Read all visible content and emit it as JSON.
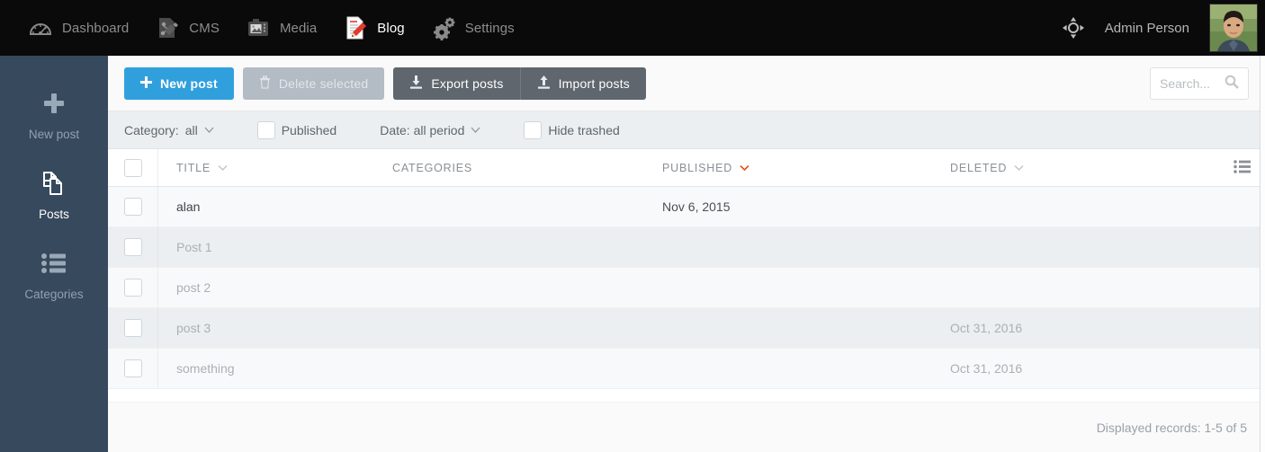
{
  "topbar": {
    "nav": [
      {
        "label": "Dashboard",
        "icon": "gauge-icon",
        "active": false
      },
      {
        "label": "CMS",
        "icon": "sitemap-document-icon",
        "active": false
      },
      {
        "label": "Media",
        "icon": "camera-icon",
        "active": false
      },
      {
        "label": "Blog",
        "icon": "document-pencil-icon",
        "active": true
      },
      {
        "label": "Settings",
        "icon": "gears-icon",
        "active": false
      }
    ],
    "move_icon": "move-crosshair-icon",
    "admin_name": "Admin Person",
    "avatar": "user-avatar-photo"
  },
  "sidebar": {
    "items": [
      {
        "label": "New post",
        "icon": "plus-icon",
        "active": false
      },
      {
        "label": "Posts",
        "icon": "pages-copy-icon",
        "active": true
      },
      {
        "label": "Categories",
        "icon": "list-icon",
        "active": false
      }
    ]
  },
  "toolbar": {
    "new_post": "New post",
    "delete_selected": "Delete selected",
    "export_posts": "Export posts",
    "import_posts": "Import posts",
    "accent_color": "#30a0dd",
    "disabled_color": "#b3bcc4",
    "dark_button_color": "#5f666d"
  },
  "search": {
    "placeholder": "Search...",
    "value": "",
    "icon": "search-icon"
  },
  "filters": {
    "category_label": "Category:",
    "category_value": "all",
    "published_label": "Published",
    "published_checked": false,
    "date_label": "Date: all period",
    "hide_trashed_label": "Hide trashed",
    "hide_trashed_checked": false
  },
  "table": {
    "columns": [
      {
        "key": "title",
        "label": "TITLE",
        "sortable": true,
        "sort_active": false
      },
      {
        "key": "categories",
        "label": "CATEGORIES",
        "sortable": false,
        "sort_active": false
      },
      {
        "key": "published",
        "label": "PUBLISHED",
        "sortable": true,
        "sort_active": true
      },
      {
        "key": "deleted",
        "label": "DELETED",
        "sortable": true,
        "sort_active": false
      }
    ],
    "sort_active_color": "#e0531f",
    "columns_icon": "column-settings-icon",
    "select_all_checked": false,
    "rows": [
      {
        "checked": false,
        "title": "alan",
        "categories": "",
        "published": "Nov 6, 2015",
        "deleted": "",
        "active": true
      },
      {
        "checked": false,
        "title": "Post 1",
        "categories": "",
        "published": "",
        "deleted": "",
        "active": false
      },
      {
        "checked": false,
        "title": "post 2",
        "categories": "",
        "published": "",
        "deleted": "",
        "active": false
      },
      {
        "checked": false,
        "title": "post 3",
        "categories": "",
        "published": "",
        "deleted": "Oct 31, 2016",
        "active": false
      },
      {
        "checked": false,
        "title": "something",
        "categories": "",
        "published": "",
        "deleted": "Oct 31, 2016",
        "active": false
      }
    ]
  },
  "footer": {
    "records_text": "Displayed records: 1-5 of 5"
  }
}
